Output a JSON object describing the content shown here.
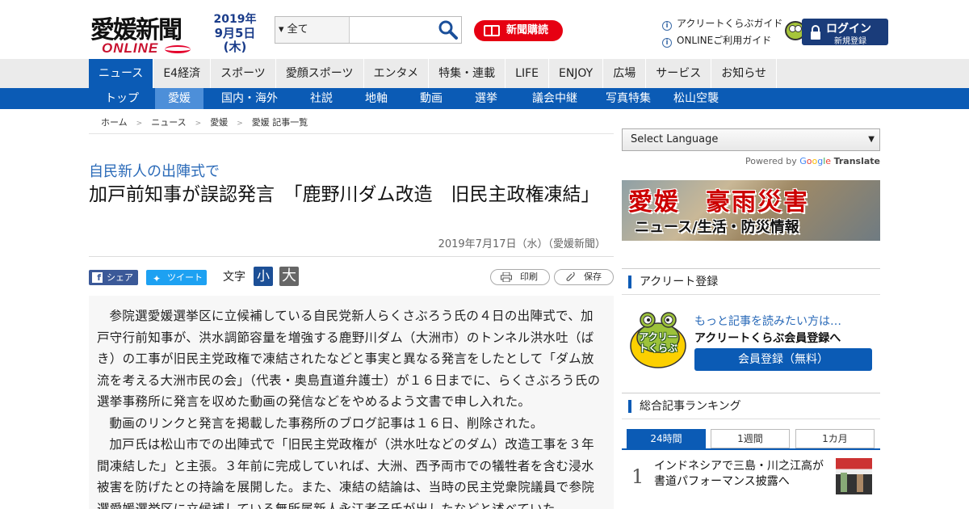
{
  "header": {
    "logo_text": "愛媛新聞",
    "logo_sub": "ONLINE",
    "date_year": "2019年",
    "date_day": "9月5日(木)",
    "search": {
      "scope": "▾ 全て",
      "placeholder": ""
    },
    "subscribe_label": "新聞購読",
    "links": {
      "guide": "アクリートくらぶガイド",
      "online": "ONLINEご利用ガイド"
    },
    "login": {
      "label": "ログイン",
      "sub": "新規登録"
    }
  },
  "nav": {
    "main": [
      "ニュース",
      "E4経済",
      "スポーツ",
      "愛顔スポーツ",
      "エンタメ",
      "特集・連載",
      "LIFE",
      "ENJOY",
      "広場",
      "サービス",
      "お知らせ"
    ],
    "main_active": "ニュース",
    "sub": [
      "トップ",
      "愛媛",
      "国内・海外",
      "社説",
      "地軸",
      "動画",
      "選挙",
      "議会中継",
      "写真特集",
      "松山空襲"
    ],
    "sub_active": "愛媛"
  },
  "breadcrumb": [
    "ホーム",
    "ニュース",
    "愛媛",
    "愛媛 記事一覧"
  ],
  "article": {
    "subtitle": "自民新人の出陣式で",
    "title": "加戸前知事が誤認発言　「鹿野川ダム改造　旧民主政権凍結」",
    "date": "2019年7月17日（水）（愛媛新聞）",
    "share": {
      "facebook": "シェア",
      "twitter": "ツイート"
    },
    "fontsize_label": "文字",
    "fontsize_small": "小",
    "fontsize_large": "大",
    "print_label": "印刷",
    "save_label": "保存",
    "paragraphs": [
      "参院選愛媛選挙区に立候補している自民党新人らくさぶろう氏の４日の出陣式で、加戸守行前知事が、洪水調節容量を増強する鹿野川ダム（大洲市）のトンネル洪水吐（ばき）の工事が旧民主党政権で凍結されたなどと事実と異なる発言をしたとして「ダム放流を考える大洲市民の会」（代表・奥島直道弁護士）が１６日までに、らくさぶろう氏の選挙事務所に発言を収めた動画の発信などをやめるよう文書で申し入れた。",
      "動画のリンクと発言を掲載した事務所のブログ記事は１６日、削除された。",
      "加戸氏は松山市での出陣式で「旧民主党政権が（洪水吐などのダム）改造工事を３年間凍結した」と主張。３年前に完成していれば、大洲、西予両市での犠牲者を含む浸水被害を防げたとの持論を展開した。また、凍結の結論は、当時の民主党衆院議員で参院選愛媛選挙区に立候補している無所属新人永江孝子氏が出したなどと述べていた。"
    ]
  },
  "sidebar": {
    "language": "Select Language",
    "powered_by": "Powered by",
    "google": [
      "G",
      "o",
      "o",
      "g",
      "l",
      "e"
    ],
    "translate": "Translate",
    "banner": {
      "line1": "愛媛　豪雨災害",
      "line2": "ニュース/生活・防災情報"
    },
    "acurite": {
      "heading": "アクリート登録",
      "mascot_text": "アクリートくらぶ",
      "promo": "もっと記事を読みたい方は…",
      "promo_sub": "アクリートくらぶ会員登録へ",
      "register": "会員登録（無料）"
    },
    "ranking": {
      "heading": "総合記事ランキング",
      "tabs": [
        "24時間",
        "1週間",
        "1カ月"
      ],
      "items": [
        {
          "rank": "1",
          "title": "インドネシアで三島・川之江高が書道パフォーマンス披露へ"
        }
      ]
    }
  },
  "colors": {
    "brand_blue": "#0b5bb5",
    "brand_red": "#e60012",
    "link_blue": "#2a6ab8"
  }
}
